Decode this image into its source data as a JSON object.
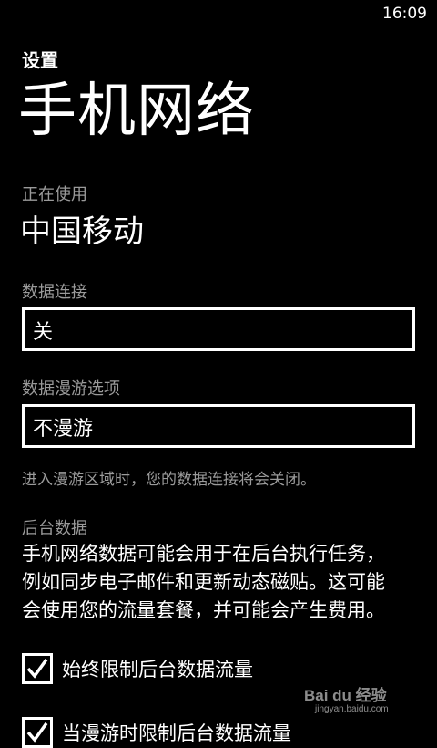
{
  "status_bar": {
    "time": "16:09"
  },
  "header": {
    "app_title": "设置",
    "page_title": "手机网络"
  },
  "current_network": {
    "label": "正在使用",
    "value": "中国移动"
  },
  "data_connection": {
    "label": "数据连接",
    "value": "关"
  },
  "roaming": {
    "label": "数据漫游选项",
    "value": "不漫游",
    "note": "进入漫游区域时，您的数据连接将会关闭。"
  },
  "background_data": {
    "label": "后台数据",
    "description_lines": [
      "手机网络数据可能会用于在后台执行任务，",
      "例如同步电子邮件和更新动态磁贴。这可能",
      "会使用您的流量套餐，并可能会产生费用。"
    ]
  },
  "checkboxes": [
    {
      "label": "始终限制后台数据流量",
      "checked": true
    },
    {
      "label": "当漫游时限制后台数据流量",
      "checked": true
    }
  ],
  "watermark": {
    "logo": "Bai du 经验",
    "sub": "jingyan.baidu.com"
  },
  "colors": {
    "background": "#000000",
    "text": "#ffffff",
    "secondary_text": "#9a9a9a"
  }
}
